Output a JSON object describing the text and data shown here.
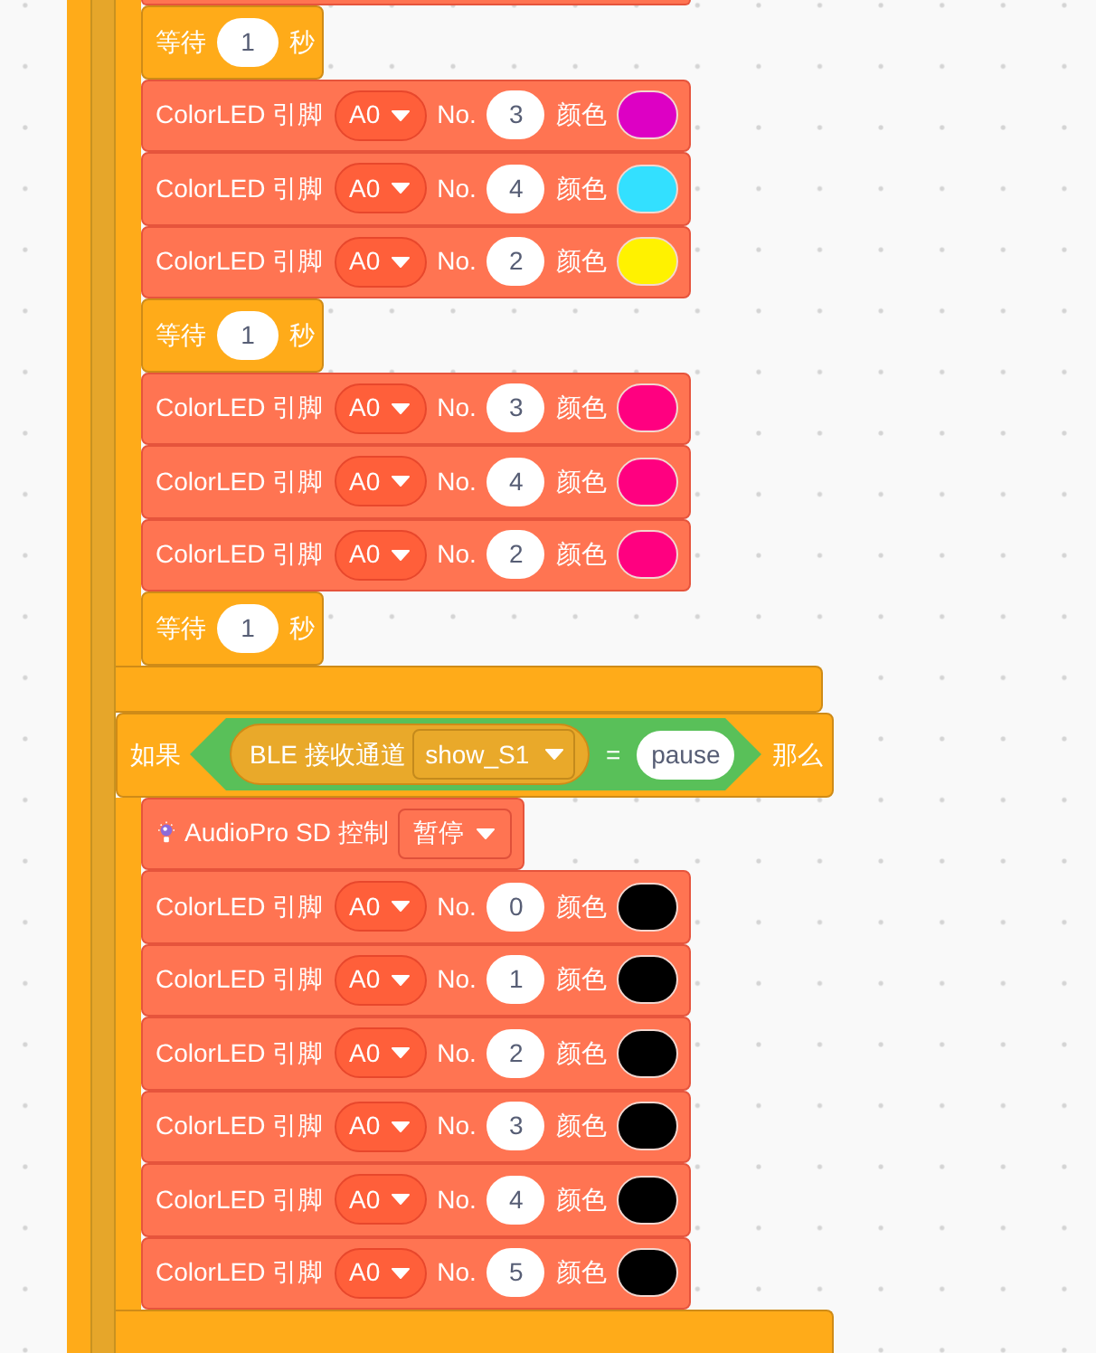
{
  "canvas": {
    "upper_branch_blocks": [
      {
        "kind": "wait",
        "label": "等待",
        "value": "1",
        "unit": "秒"
      },
      {
        "kind": "color_led",
        "label": "ColorLED 引脚",
        "pin": "A0",
        "number_label": "No.",
        "number": "3",
        "color_label": "颜色",
        "color": "#dd00c4"
      },
      {
        "kind": "color_led",
        "label": "ColorLED 引脚",
        "pin": "A0",
        "number_label": "No.",
        "number": "4",
        "color_label": "颜色",
        "color": "#33e0ff"
      },
      {
        "kind": "color_led",
        "label": "ColorLED 引脚",
        "pin": "A0",
        "number_label": "No.",
        "number": "2",
        "color_label": "颜色",
        "color": "#fff200"
      },
      {
        "kind": "wait",
        "label": "等待",
        "value": "1",
        "unit": "秒"
      },
      {
        "kind": "color_led",
        "label": "ColorLED 引脚",
        "pin": "A0",
        "number_label": "No.",
        "number": "3",
        "color_label": "颜色",
        "color": "#ff0080"
      },
      {
        "kind": "color_led",
        "label": "ColorLED 引脚",
        "pin": "A0",
        "number_label": "No.",
        "number": "4",
        "color_label": "颜色",
        "color": "#ff0080"
      },
      {
        "kind": "color_led",
        "label": "ColorLED 引脚",
        "pin": "A0",
        "number_label": "No.",
        "number": "2",
        "color_label": "颜色",
        "color": "#ff0080"
      },
      {
        "kind": "wait",
        "label": "等待",
        "value": "1",
        "unit": "秒"
      }
    ],
    "if_block": {
      "label": "如果",
      "condition": {
        "label": "BLE 接收通道",
        "channel": "show_S1",
        "operator": "=",
        "value": "pause"
      },
      "then_label": "那么",
      "body": [
        {
          "kind": "audio_control",
          "label": "AudioPro SD 控制",
          "action": "暂停"
        },
        {
          "kind": "color_led",
          "label": "ColorLED 引脚",
          "pin": "A0",
          "number_label": "No.",
          "number": "0",
          "color_label": "颜色",
          "color": "#000000"
        },
        {
          "kind": "color_led",
          "label": "ColorLED 引脚",
          "pin": "A0",
          "number_label": "No.",
          "number": "1",
          "color_label": "颜色",
          "color": "#000000"
        },
        {
          "kind": "color_led",
          "label": "ColorLED 引脚",
          "pin": "A0",
          "number_label": "No.",
          "number": "2",
          "color_label": "颜色",
          "color": "#000000"
        },
        {
          "kind": "color_led",
          "label": "ColorLED 引脚",
          "pin": "A0",
          "number_label": "No.",
          "number": "3",
          "color_label": "颜色",
          "color": "#000000"
        },
        {
          "kind": "color_led",
          "label": "ColorLED 引脚",
          "pin": "A0",
          "number_label": "No.",
          "number": "4",
          "color_label": "颜色",
          "color": "#000000"
        },
        {
          "kind": "color_led",
          "label": "ColorLED 引脚",
          "pin": "A0",
          "number_label": "No.",
          "number": "5",
          "color_label": "颜色",
          "color": "#000000"
        }
      ]
    }
  }
}
